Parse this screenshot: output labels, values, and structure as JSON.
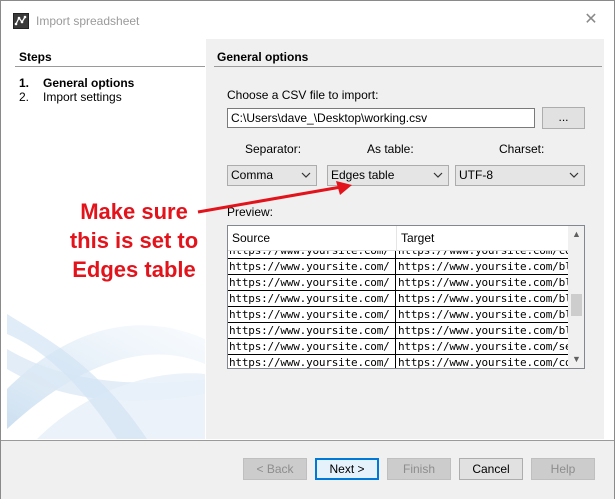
{
  "window": {
    "title": "Import spreadsheet",
    "close_glyph": "✕"
  },
  "steps": {
    "header": "Steps",
    "items": [
      {
        "number": "1.",
        "label": "General options",
        "active": true
      },
      {
        "number": "2.",
        "label": "Import settings",
        "active": false
      }
    ]
  },
  "general": {
    "header": "General options",
    "file_label": "Choose a CSV file to import:",
    "file_path": "C:\\Users\\dave_\\Desktop\\working.csv",
    "browse_label": "...",
    "separator_label": "Separator:",
    "as_table_label": "As table:",
    "charset_label": "Charset:",
    "separator_value": "Comma",
    "as_table_value": "Edges table",
    "charset_value": "UTF-8",
    "preview_label": "Preview:"
  },
  "preview": {
    "columns": [
      "Source",
      "Target"
    ],
    "rows": [
      [
        "https://www.yoursite.com/",
        "https://www.yoursite.com/com..."
      ],
      [
        "https://www.yoursite.com/",
        "https://www.yoursite.com/blog/"
      ],
      [
        "https://www.yoursite.com/",
        "https://www.yoursite.com/blog/..."
      ],
      [
        "https://www.yoursite.com/",
        "https://www.yoursite.com/blog/..."
      ],
      [
        "https://www.yoursite.com/",
        "https://www.yoursite.com/blog-..."
      ],
      [
        "https://www.yoursite.com/",
        "https://www.yoursite.com/blog-..."
      ],
      [
        "https://www.yoursite.com/",
        "https://www.yoursite.com/servi..."
      ],
      [
        "https://www.yoursite.com/",
        "https://www.yoursite.com/cont..."
      ]
    ]
  },
  "buttons": {
    "back": "< Back",
    "next": "Next >",
    "finish": "Finish",
    "cancel": "Cancel",
    "help": "Help"
  },
  "annotation": {
    "lines": [
      "Make sure",
      "this is set to",
      "Edges table"
    ],
    "color": "#e2131b"
  },
  "icons": {
    "app": "spreadsheet-app-icon",
    "close": "close-icon",
    "dropdown": "chevron-down-icon",
    "scroll_up": "scroll-up-icon",
    "scroll_down": "scroll-down-icon"
  }
}
